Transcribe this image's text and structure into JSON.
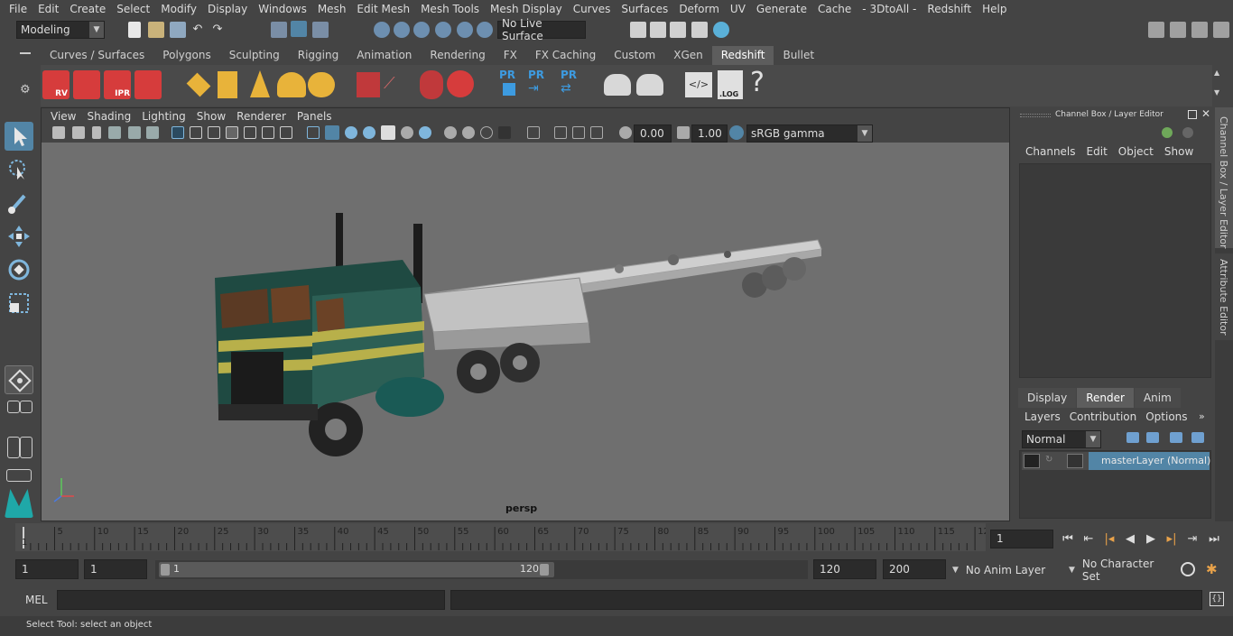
{
  "menu": [
    "File",
    "Edit",
    "Create",
    "Select",
    "Modify",
    "Display",
    "Windows",
    "Mesh",
    "Edit Mesh",
    "Mesh Tools",
    "Mesh Display",
    "Curves",
    "Surfaces",
    "Deform",
    "UV",
    "Generate",
    "Cache",
    "- 3DtoAll -",
    "Redshift",
    "Help"
  ],
  "status": {
    "mode": "Modeling",
    "live_surface": "No Live Surface"
  },
  "shelf_tabs": [
    "Curves / Surfaces",
    "Polygons",
    "Sculpting",
    "Rigging",
    "Animation",
    "Rendering",
    "FX",
    "FX Caching",
    "Custom",
    "XGen",
    "Redshift",
    "Bullet"
  ],
  "shelf_active": "Redshift",
  "shelf_labels": {
    "rv": "RV",
    "ipr": "IPR",
    "pr": "PR",
    "log": ".LOG"
  },
  "panel_menu": [
    "View",
    "Shading",
    "Lighting",
    "Show",
    "Renderer",
    "Panels"
  ],
  "panel_tools": {
    "near": "0.00",
    "far": "1.00",
    "colorspace": "sRGB gamma"
  },
  "viewport": {
    "camera_label": "persp"
  },
  "channel_box": {
    "title": "Channel Box / Layer Editor",
    "menu": [
      "Channels",
      "Edit",
      "Object",
      "Show"
    ],
    "layer_tabs": [
      "Display",
      "Render",
      "Anim"
    ],
    "layer_active": "Render",
    "layer_menu": [
      "Layers",
      "Contribution",
      "Options"
    ],
    "blend_mode": "Normal",
    "layer_name": "masterLayer (Normal)"
  },
  "side_tabs": [
    "Channel Box / Layer Editor",
    "Attribute Editor"
  ],
  "timeline": {
    "ticks": [
      "5",
      "10",
      "15",
      "20",
      "25",
      "30",
      "35",
      "40",
      "45",
      "50",
      "55",
      "60",
      "65",
      "70",
      "75",
      "80",
      "85",
      "90",
      "95",
      "100",
      "105",
      "110",
      "115",
      "12"
    ],
    "start_label": "1",
    "current_frame": "1"
  },
  "range": {
    "start": "1",
    "playback_start": "1",
    "slider_start": "1",
    "slider_end": "120",
    "end": "120",
    "anim_end": "200",
    "anim_layer": "No Anim Layer",
    "character_set": "No Character Set"
  },
  "command": {
    "lang": "MEL"
  },
  "help_line": "Select Tool: select an object",
  "colors": {
    "accent": "#5285a6",
    "redshift_red": "#d63c3c",
    "bg": "#444444"
  }
}
